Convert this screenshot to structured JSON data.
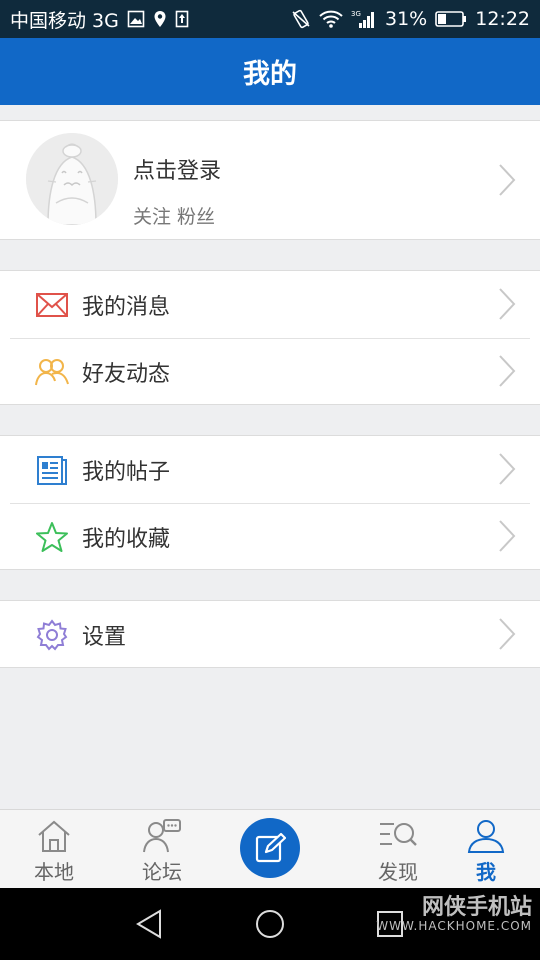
{
  "status_bar": {
    "carrier": "中国移动 3G",
    "network": "3G",
    "battery": "31%",
    "time": "12:22"
  },
  "header": {
    "title": "我的"
  },
  "profile": {
    "login_label": "点击登录",
    "follow_label": "关注 粉丝"
  },
  "menu": {
    "messages": {
      "label": "我的消息",
      "icon": "envelope-icon"
    },
    "friends": {
      "label": "好友动态",
      "icon": "friends-icon"
    },
    "posts": {
      "label": "我的帖子",
      "icon": "document-icon"
    },
    "favorites": {
      "label": "我的收藏",
      "icon": "star-icon"
    },
    "settings": {
      "label": "设置",
      "icon": "gear-icon"
    }
  },
  "tabs": {
    "local": {
      "label": "本地",
      "icon": "home-icon"
    },
    "forum": {
      "label": "论坛",
      "icon": "forum-icon"
    },
    "compose": {
      "icon": "compose-icon"
    },
    "discover": {
      "label": "发现",
      "icon": "discover-icon"
    },
    "me": {
      "label": "我",
      "icon": "user-icon",
      "active": true
    }
  },
  "watermark": {
    "title": "网侠手机站",
    "url": "WWW.HACKHOME.COM"
  },
  "colors": {
    "brand_blue": "#1168c7",
    "status_bar": "#0f2a3c",
    "background": "#eeeff1"
  }
}
